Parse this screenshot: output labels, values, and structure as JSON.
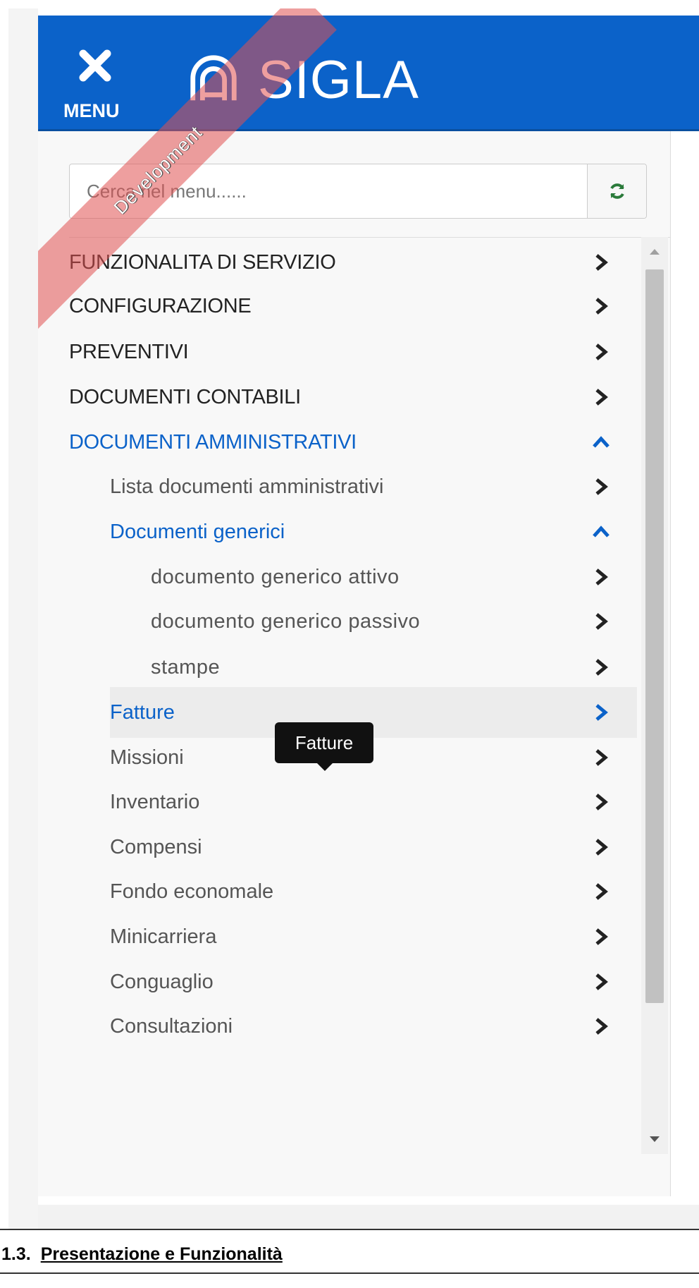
{
  "header": {
    "menu_label": "MENU",
    "brand_name": "SIGLA"
  },
  "ribbon": {
    "text": "Development"
  },
  "search": {
    "placeholder": "Cerca nel menu......",
    "value": ""
  },
  "tooltip": {
    "text": "Fatture"
  },
  "menu": {
    "items": [
      {
        "label": "FUNZIONALITA DI SERVIZIO",
        "level": 0
      },
      {
        "label": "CONFIGURAZIONE",
        "level": 0
      },
      {
        "label": "PREVENTIVI",
        "level": 0
      },
      {
        "label": "DOCUMENTI CONTABILI",
        "level": 0
      },
      {
        "label": "DOCUMENTI AMMINISTRATIVI",
        "level": 0,
        "expanded": true
      },
      {
        "label": "Lista documenti amministrativi",
        "level": 1
      },
      {
        "label": "Documenti generici",
        "level": 1,
        "expanded": true
      },
      {
        "label": "documento generico attivo",
        "level": 2
      },
      {
        "label": "documento generico passivo",
        "level": 2
      },
      {
        "label": "stampe",
        "level": 2
      },
      {
        "label": "Fatture",
        "level": 1,
        "hovered": true
      },
      {
        "label": "Missioni",
        "level": 1
      },
      {
        "label": "Inventario",
        "level": 1
      },
      {
        "label": "Compensi",
        "level": 1
      },
      {
        "label": "Fondo economale",
        "level": 1
      },
      {
        "label": "Minicarriera",
        "level": 1
      },
      {
        "label": "Conguaglio",
        "level": 1
      },
      {
        "label": "Consultazioni",
        "level": 1
      }
    ]
  },
  "colors": {
    "primary": "#0b62c9",
    "text_dark": "#222222",
    "text_muted": "#555555",
    "ribbon": "#e05050",
    "refresh_icon": "#2a7a3a"
  },
  "doc": {
    "section_number": "1.3.",
    "section_title": "Presentazione e Funzionalità"
  }
}
